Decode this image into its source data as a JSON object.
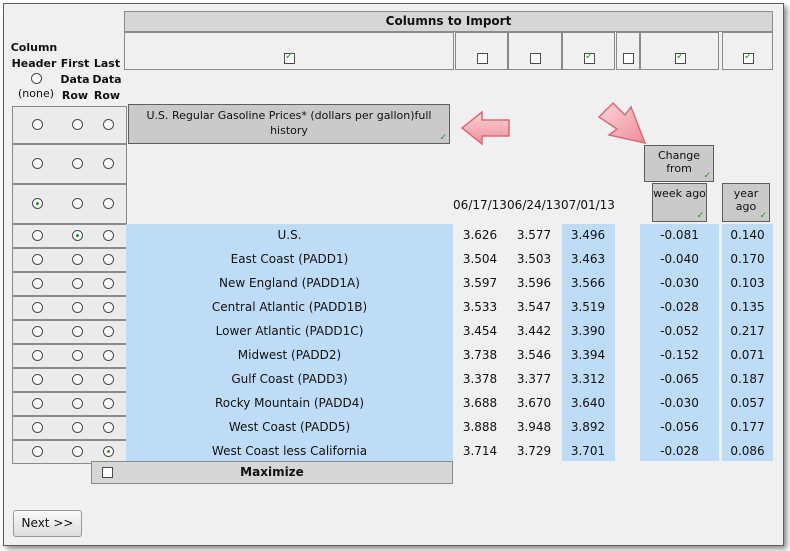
{
  "header": {
    "columns_to_import": "Columns to Import",
    "column_header_label": "Column Header",
    "first_data_row_label": "First Data Row",
    "last_data_row_label": "Last Data Row",
    "none_option": "(none)"
  },
  "import_checkboxes": [
    true,
    false,
    false,
    true,
    false,
    true,
    true
  ],
  "title_cell": {
    "text": "U.S. Regular Gasoline Prices*  (dollars per gallon)full history"
  },
  "change_from": {
    "label": "Change from",
    "week_ago": "week ago",
    "year_ago": "year ago"
  },
  "dates": [
    "06/17/13",
    "06/24/13",
    "07/01/13"
  ],
  "row_radios": [
    {
      "col": 0,
      "first": 0,
      "last": 0
    },
    {
      "col": 0,
      "first": 0,
      "last": 0
    },
    {
      "col": 1,
      "first": 0,
      "last": 0
    },
    {
      "col": 0,
      "first": 1,
      "last": 0
    },
    {
      "col": 0,
      "first": 0,
      "last": 0
    },
    {
      "col": 0,
      "first": 0,
      "last": 0
    },
    {
      "col": 0,
      "first": 0,
      "last": 0
    },
    {
      "col": 0,
      "first": 0,
      "last": 0
    },
    {
      "col": 0,
      "first": 0,
      "last": 0
    },
    {
      "col": 0,
      "first": 0,
      "last": 0
    },
    {
      "col": 0,
      "first": 0,
      "last": 0
    },
    {
      "col": 0,
      "first": 0,
      "last": 0
    },
    {
      "col": 0,
      "first": 0,
      "last": 1
    }
  ],
  "rows": [
    {
      "region": "U.S.",
      "v1": "3.626",
      "v2": "3.577",
      "v3": "3.496",
      "week": "-0.081",
      "year": "0.140"
    },
    {
      "region": "East Coast (PADD1)",
      "v1": "3.504",
      "v2": "3.503",
      "v3": "3.463",
      "week": "-0.040",
      "year": "0.170"
    },
    {
      "region": "New England (PADD1A)",
      "v1": "3.597",
      "v2": "3.596",
      "v3": "3.566",
      "week": "-0.030",
      "year": "0.103"
    },
    {
      "region": "Central Atlantic (PADD1B)",
      "v1": "3.533",
      "v2": "3.547",
      "v3": "3.519",
      "week": "-0.028",
      "year": "0.135"
    },
    {
      "region": "Lower Atlantic (PADD1C)",
      "v1": "3.454",
      "v2": "3.442",
      "v3": "3.390",
      "week": "-0.052",
      "year": "0.217"
    },
    {
      "region": "Midwest (PADD2)",
      "v1": "3.738",
      "v2": "3.546",
      "v3": "3.394",
      "week": "-0.152",
      "year": "0.071"
    },
    {
      "region": "Gulf Coast (PADD3)",
      "v1": "3.378",
      "v2": "3.377",
      "v3": "3.312",
      "week": "-0.065",
      "year": "0.187"
    },
    {
      "region": "Rocky Mountain (PADD4)",
      "v1": "3.688",
      "v2": "3.670",
      "v3": "3.640",
      "week": "-0.030",
      "year": "0.057"
    },
    {
      "region": "West Coast (PADD5)",
      "v1": "3.888",
      "v2": "3.948",
      "v3": "3.892",
      "week": "-0.056",
      "year": "0.177"
    },
    {
      "region": "West Coast less California",
      "v1": "3.714",
      "v2": "3.729",
      "v3": "3.701",
      "week": "-0.028",
      "year": "0.086"
    }
  ],
  "maximize_label": "Maximize",
  "next_button": "Next >>",
  "colors": {
    "highlight": "#bfdcf7",
    "check": "#1c9a1c",
    "callout_arrow": "#f4a8b0"
  }
}
